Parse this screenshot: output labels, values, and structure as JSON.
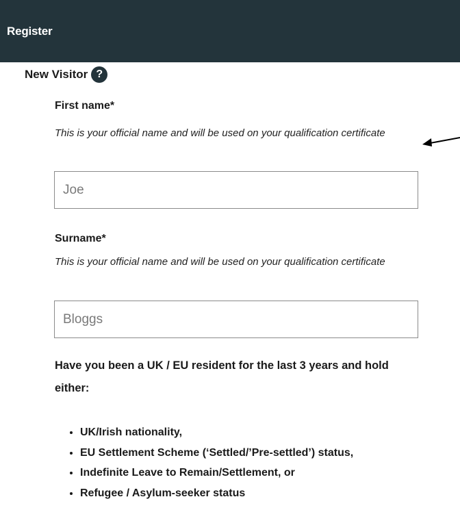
{
  "header": {
    "title": "Register"
  },
  "section": {
    "title": "New Visitor",
    "help_icon": "?"
  },
  "first_name": {
    "label": "First name*",
    "hint": "This is your official name and will be used on your qualification certificate",
    "placeholder": "Joe"
  },
  "surname": {
    "label": "Surname*",
    "hint": "This is your official name and will be used on your qualification certificate",
    "placeholder": "Bloggs"
  },
  "residency": {
    "question": "Have you been a UK / EU resident for the last 3 years and hold either:",
    "options": [
      "UK/Irish nationality,",
      "EU Settlement Scheme (‘Settled/’Pre-settled’) status,",
      "Indefinite Leave to Remain/Settlement, or",
      "Refugee / Asylum-seeker status"
    ]
  },
  "colors": {
    "header_bg": "#23343b",
    "header_text": "#ffffff"
  },
  "icons": {
    "help": "question-circle-icon",
    "annotation": "arrow-left-icon"
  }
}
